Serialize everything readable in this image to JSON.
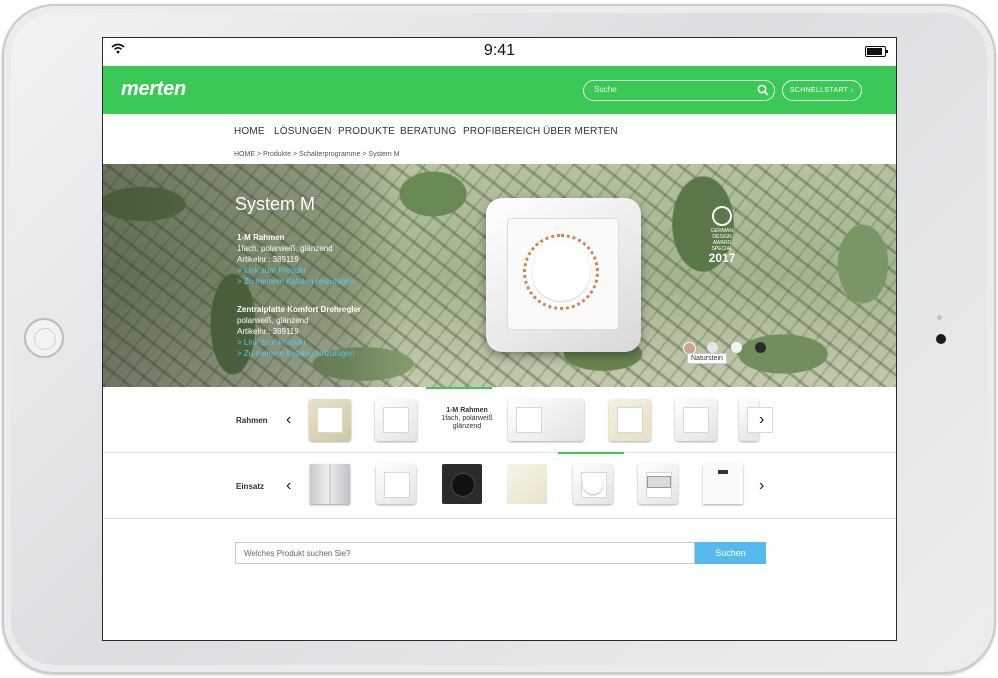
{
  "status_bar": {
    "time": "9:41"
  },
  "header": {
    "logo": "merten",
    "search_placeholder": "Suche",
    "quickstart_label": "SCHNELLSTART ↓"
  },
  "nav": {
    "items": [
      "HOME",
      "LÖSUNGEN",
      "PRODUKTE",
      "BERATUNG",
      "PROFIBEREICH",
      "ÜBER MERTEN"
    ]
  },
  "breadcrumb": "HOME  >  Produkte  >  Schalterprogramme  >  System M",
  "hero": {
    "title": "System M",
    "product1": {
      "name": "1-M Rahmen",
      "desc": "1fach, polarweiß, glänzend",
      "article": "Artikelnr.: 389119",
      "link1": "> Link zum Produkt",
      "link2": "> Zu meinem Katalog hinzufügen"
    },
    "product2": {
      "name": "Zentralplatte Komfort Drehregler",
      "desc": "polarweiß, glänzend",
      "article": "Artikelnr.: 389119",
      "link1": "> Link zum Produkt",
      "link2": "> Zu meinem Katalog hinzufügen"
    },
    "award": {
      "line1": "GERMAN",
      "line2": "DESIGN",
      "line3": "AWARD",
      "line4": "SPECIAL",
      "year": "2017"
    },
    "swatch_label": "Naturstein",
    "swatch_colors": [
      "#c9a58f",
      "#e6e6e6",
      "#f3f3f3",
      "#2b2b2b"
    ]
  },
  "rahmen_row": {
    "label": "Rahmen",
    "selected_name": "1-M Rahmen",
    "selected_desc1": "1fach, polarweiß",
    "selected_desc2": "glänzend"
  },
  "einsatz_row": {
    "label": "Einsatz"
  },
  "product_search": {
    "placeholder": "Welches Produkt suchen Sie?",
    "button": "Suchen"
  },
  "colors": {
    "brand_green": "#3ac957",
    "link_blue": "#5ec3f0",
    "button_blue": "#55b9ee"
  }
}
